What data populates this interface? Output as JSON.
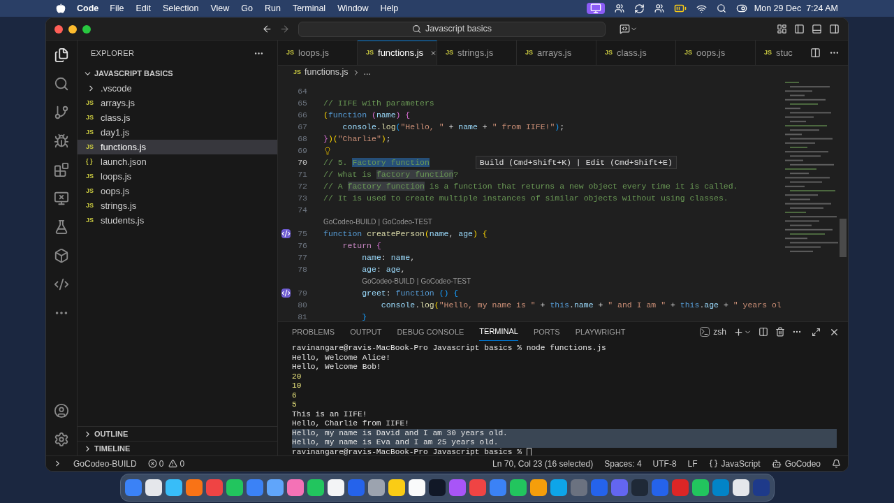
{
  "menu_bar": {
    "app": "Code",
    "menus": [
      "File",
      "Edit",
      "Selection",
      "View",
      "Go",
      "Run",
      "Terminal",
      "Window",
      "Help"
    ],
    "clock": "Mon 29 Dec  7:24 AM"
  },
  "title_bar": {
    "search": "Javascript basics"
  },
  "sidebar": {
    "title": "EXPLORER",
    "folder": "JAVASCRIPT BASICS",
    "items": [
      {
        "kind": "folder",
        "label": ".vscode",
        "selected": false
      },
      {
        "kind": "file",
        "icon": "JS",
        "label": "arrays.js",
        "selected": false
      },
      {
        "kind": "file",
        "icon": "JS",
        "label": "class.js",
        "selected": false
      },
      {
        "kind": "file",
        "icon": "JS",
        "label": "day1.js",
        "selected": false
      },
      {
        "kind": "file",
        "icon": "JS",
        "label": "functions.js",
        "selected": true
      },
      {
        "kind": "file",
        "icon": "{ }",
        "label": "launch.json",
        "selected": false
      },
      {
        "kind": "file",
        "icon": "JS",
        "label": "loops.js",
        "selected": false
      },
      {
        "kind": "file",
        "icon": "JS",
        "label": "oops.js",
        "selected": false
      },
      {
        "kind": "file",
        "icon": "JS",
        "label": "strings.js",
        "selected": false
      },
      {
        "kind": "file",
        "icon": "JS",
        "label": "students.js",
        "selected": false
      }
    ],
    "sections": [
      "OUTLINE",
      "TIMELINE"
    ]
  },
  "tabs": [
    {
      "icon": "JS",
      "label": "loops.js",
      "selected": false
    },
    {
      "icon": "JS",
      "label": "functions.js",
      "selected": true
    },
    {
      "icon": "JS",
      "label": "strings.js",
      "selected": false
    },
    {
      "icon": "JS",
      "label": "arrays.js",
      "selected": false
    },
    {
      "icon": "JS",
      "label": "class.js",
      "selected": false
    },
    {
      "icon": "JS",
      "label": "oops.js",
      "selected": false
    },
    {
      "icon": "JS",
      "label": "stuc",
      "selected": false
    }
  ],
  "breadcrumb": {
    "icon": "JS",
    "file": "functions.js",
    "rest": "..."
  },
  "editor": {
    "lines": [
      {
        "kind": "code",
        "number": "64",
        "current": false
      },
      {
        "kind": "code",
        "number": "65",
        "current": false,
        "tokens": [
          {
            "kind": "comment",
            "text": "// IIFE with parameters"
          }
        ]
      },
      {
        "kind": "code",
        "number": "66",
        "current": false,
        "tokens": [
          {
            "kind": "gold",
            "text": "("
          },
          {
            "kind": "keyword",
            "text": "function "
          },
          {
            "kind": "pink",
            "text": "("
          },
          {
            "kind": "param",
            "text": "name"
          },
          {
            "kind": "pink",
            "text": ")"
          },
          {
            "kind": "pink",
            "text": " {"
          }
        ]
      },
      {
        "kind": "code",
        "number": "67",
        "current": false,
        "tokens": [
          {
            "kind": "variable",
            "text": "    console"
          },
          {
            "kind": "plain",
            "text": "."
          },
          {
            "kind": "function",
            "text": "log"
          },
          {
            "kind": "blue",
            "text": "("
          },
          {
            "kind": "string",
            "text": "\"Hello, \""
          },
          {
            "kind": "plain",
            "text": " + "
          },
          {
            "kind": "variable",
            "text": "name"
          },
          {
            "kind": "plain",
            "text": " + "
          },
          {
            "kind": "string",
            "text": "\" from IIFE!\""
          },
          {
            "kind": "blue",
            "text": ")"
          },
          {
            "kind": "plain",
            "text": ";"
          }
        ]
      },
      {
        "kind": "code",
        "number": "68",
        "current": false,
        "tokens": [
          {
            "kind": "pink",
            "text": "}"
          },
          {
            "kind": "gold",
            "text": ")"
          },
          {
            "kind": "gold",
            "text": "("
          },
          {
            "kind": "string",
            "text": "\"Charlie\""
          },
          {
            "kind": "gold",
            "text": ")"
          },
          {
            "kind": "plain",
            "text": ";"
          }
        ]
      },
      {
        "kind": "code",
        "number": "69",
        "current": false,
        "gutter": {
          "kind": "lightbulb"
        }
      },
      {
        "kind": "code",
        "number": "70",
        "current": true,
        "hint": "Build (Cmd+Shift+K) | Edit (Cmd+Shift+E)",
        "tokens": [
          {
            "kind": "comment",
            "text": "// 5. "
          },
          {
            "kind": "comment-selected",
            "text": "Factory function"
          }
        ]
      },
      {
        "kind": "code",
        "number": "71",
        "current": false,
        "tokens": [
          {
            "kind": "comment",
            "text": "// what is "
          },
          {
            "kind": "comment-match",
            "text": "factory function"
          },
          {
            "kind": "comment",
            "text": "?"
          }
        ]
      },
      {
        "kind": "code",
        "number": "72",
        "current": false,
        "tokens": [
          {
            "kind": "comment",
            "text": "// A "
          },
          {
            "kind": "comment-match",
            "text": "factory function"
          },
          {
            "kind": "comment",
            "text": " is a function that returns a new object every time it is called."
          }
        ]
      },
      {
        "kind": "code",
        "number": "73",
        "current": false,
        "tokens": [
          {
            "kind": "comment",
            "text": "// It is used to create multiple instances of similar objects without using classes."
          }
        ]
      },
      {
        "kind": "code",
        "number": "74",
        "current": false
      },
      {
        "kind": "codelens",
        "links": [
          "GoCodeo-BUILD",
          "GoCodeo-TEST"
        ],
        "separator": "|"
      },
      {
        "kind": "code",
        "number": "75",
        "current": false,
        "gutter": {
          "kind": "gocodeo"
        },
        "tokens": [
          {
            "kind": "keyword",
            "text": "function "
          },
          {
            "kind": "function",
            "text": "createPerson"
          },
          {
            "kind": "gold",
            "text": "("
          },
          {
            "kind": "param",
            "text": "name"
          },
          {
            "kind": "plain",
            "text": ", "
          },
          {
            "kind": "param",
            "text": "age"
          },
          {
            "kind": "gold",
            "text": ")"
          },
          {
            "kind": "gold",
            "text": " {"
          }
        ]
      },
      {
        "kind": "code",
        "number": "76",
        "current": false,
        "tokens": [
          {
            "kind": "control",
            "text": "    return"
          },
          {
            "kind": "pink",
            "text": " {"
          }
        ]
      },
      {
        "kind": "code",
        "number": "77",
        "current": false,
        "tokens": [
          {
            "kind": "variable",
            "text": "        name"
          },
          {
            "kind": "plain",
            "text": ": "
          },
          {
            "kind": "variable",
            "text": "name"
          },
          {
            "kind": "plain",
            "text": ","
          }
        ]
      },
      {
        "kind": "code",
        "number": "78",
        "current": false,
        "tokens": [
          {
            "kind": "variable",
            "text": "        age"
          },
          {
            "kind": "plain",
            "text": ": "
          },
          {
            "kind": "variable",
            "text": "age"
          },
          {
            "kind": "plain",
            "text": ","
          }
        ]
      },
      {
        "kind": "codelens",
        "links": [
          "GoCodeo-BUILD",
          "GoCodeo-TEST"
        ],
        "separator": "|"
      },
      {
        "kind": "code",
        "number": "79",
        "current": false,
        "gutter": {
          "kind": "gocodeo"
        },
        "tokens": [
          {
            "kind": "variable",
            "text": "        greet"
          },
          {
            "kind": "plain",
            "text": ": "
          },
          {
            "kind": "keyword",
            "text": "function "
          },
          {
            "kind": "blue",
            "text": "("
          },
          {
            "kind": "blue",
            "text": ")"
          },
          {
            "kind": "blue",
            "text": " {"
          }
        ]
      },
      {
        "kind": "code",
        "number": "80",
        "current": false,
        "tokens": [
          {
            "kind": "variable",
            "text": "            console"
          },
          {
            "kind": "plain",
            "text": "."
          },
          {
            "kind": "function",
            "text": "log"
          },
          {
            "kind": "gold",
            "text": "("
          },
          {
            "kind": "string",
            "text": "\"Hello, my name is \""
          },
          {
            "kind": "plain",
            "text": " + "
          },
          {
            "kind": "keyword",
            "text": "this"
          },
          {
            "kind": "plain",
            "text": "."
          },
          {
            "kind": "variable",
            "text": "name"
          },
          {
            "kind": "plain",
            "text": " + "
          },
          {
            "kind": "string",
            "text": "\" and I am \""
          },
          {
            "kind": "plain",
            "text": " + "
          },
          {
            "kind": "keyword",
            "text": "this"
          },
          {
            "kind": "plain",
            "text": "."
          },
          {
            "kind": "variable",
            "text": "age"
          },
          {
            "kind": "plain",
            "text": " + "
          },
          {
            "kind": "string",
            "text": "\" years ol"
          }
        ]
      },
      {
        "kind": "code",
        "number": "81",
        "current": false,
        "tokens": [
          {
            "kind": "blue",
            "text": "        }"
          }
        ]
      }
    ]
  },
  "panel": {
    "tabs": [
      {
        "label": "PROBLEMS",
        "selected": false
      },
      {
        "label": "OUTPUT",
        "selected": false
      },
      {
        "label": "DEBUG CONSOLE",
        "selected": false
      },
      {
        "label": "TERMINAL",
        "selected": true
      },
      {
        "label": "PORTS",
        "selected": false
      },
      {
        "label": "PLAYWRIGHT",
        "selected": false
      }
    ],
    "shell": "zsh",
    "terminal": [
      {
        "kind": "prompt",
        "text": "ravinangare@ravis-MacBook-Pro Javascript basics % node functions.js",
        "selected": false
      },
      {
        "kind": "output",
        "text": "Hello, Welcome Alice!",
        "selected": false
      },
      {
        "kind": "output",
        "text": "Hello, Welcome Bob!",
        "selected": false
      },
      {
        "kind": "number",
        "text": "20",
        "selected": false
      },
      {
        "kind": "number",
        "text": "10",
        "selected": false
      },
      {
        "kind": "number",
        "text": "6",
        "selected": false
      },
      {
        "kind": "number",
        "text": "5",
        "selected": false
      },
      {
        "kind": "output",
        "text": "This is an IIFE!",
        "selected": false
      },
      {
        "kind": "output",
        "text": "Hello, Charlie from IIFE!",
        "selected": false
      },
      {
        "kind": "output",
        "text": "Hello, my name is David and I am 30 years old.",
        "selected": true
      },
      {
        "kind": "output",
        "text": "Hello, my name is Eva and I am 25 years old.",
        "selected": true
      },
      {
        "kind": "cursor-prompt",
        "text": "ravinangare@ravis-MacBook-Pro Javascript basics % ",
        "selected": false
      }
    ]
  },
  "status_bar": {
    "extension": "GoCodeo-BUILD",
    "errors": "0",
    "warnings": "0",
    "position": "Ln 70, Col 23 (16 selected)",
    "spaces": "Spaces: 4",
    "encoding": "UTF-8",
    "eol": "LF",
    "language": "JavaScript",
    "account": "GoCodeo"
  }
}
